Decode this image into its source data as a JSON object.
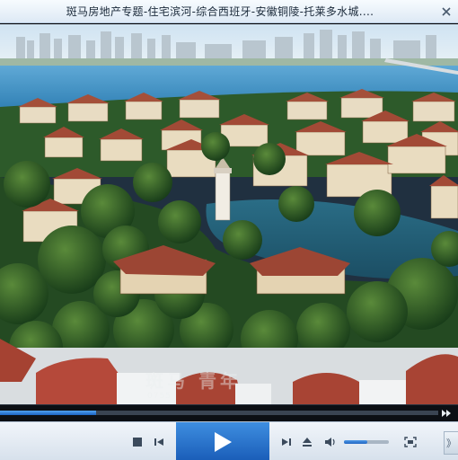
{
  "window": {
    "title": "斑马房地产专题-住宅滨河-综合西班牙-安徽铜陵-托莱多水城...."
  },
  "video": {
    "watermark_text": "斑马  青年",
    "watermark_sub": "0755"
  },
  "playback": {
    "progress_fraction": 0.22,
    "volume_fraction": 0.52
  },
  "controls": {
    "stop_icon": "stop-icon",
    "prev_icon": "previous-icon",
    "play_icon": "play-icon",
    "next_icon": "next-icon",
    "eject_icon": "eject-icon",
    "volume_icon": "speaker-icon",
    "fullscreen_icon": "fullscreen-icon",
    "side_tab_glyph": "》"
  },
  "colors": {
    "accent": "#1c64c4",
    "titlebar": "#dde9f5",
    "controls_bg": "#e4ebf3"
  }
}
